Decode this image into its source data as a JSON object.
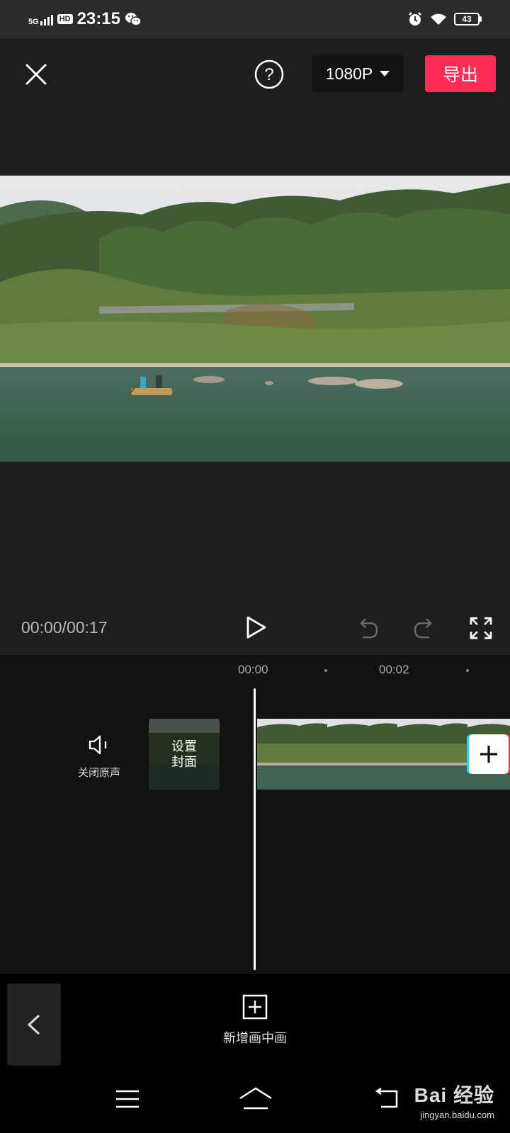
{
  "status_bar": {
    "time": "23:15",
    "network": "5G",
    "hd": "HD",
    "battery": "43"
  },
  "top_bar": {
    "resolution": "1080P",
    "export_label": "导出"
  },
  "player": {
    "time_display": "00:00/00:17"
  },
  "timeline": {
    "ruler_labels": [
      "00:00",
      "00:02"
    ],
    "mute_label": "关闭原声",
    "cover_label": "设置\n封面"
  },
  "bottom_toolbar": {
    "pip_label": "新增画中画"
  },
  "watermark": {
    "main": "Bai 经验",
    "url": "jingyan.baidu.com"
  },
  "colors": {
    "accent": "#fe2c55",
    "accent_secondary": "#26d9e6",
    "background": "#1e1e1e",
    "timeline_bg": "#121212"
  },
  "icons": [
    "close-icon",
    "help-icon",
    "caret-down-icon",
    "play-icon",
    "undo-icon",
    "redo-icon",
    "fullscreen-icon",
    "speaker-icon",
    "plus-icon",
    "chevron-left-icon",
    "add-square-icon",
    "menu-icon",
    "home-icon",
    "back-icon"
  ]
}
